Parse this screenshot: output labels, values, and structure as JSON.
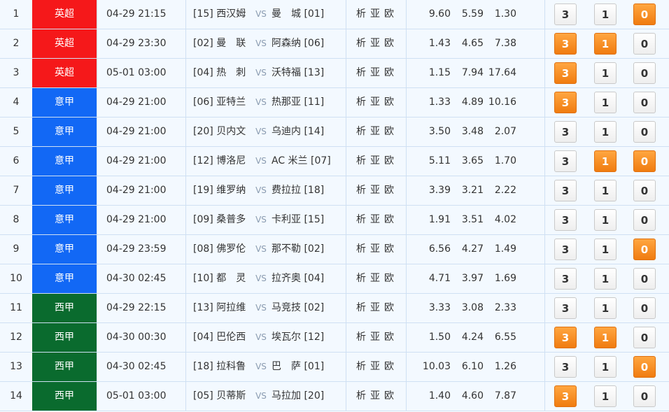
{
  "colors": {
    "epl": "#f5181a",
    "seriea": "#1268f5",
    "laliga": "#0a6b2e",
    "selected": "#f58a1a"
  },
  "separator": "VS",
  "links": "析亚欧",
  "rows": [
    {
      "num": "1",
      "league": "英超",
      "league_key": "epl",
      "time": "04-29 21:15",
      "home": "[15] 西汉姆",
      "away": "曼　城 [01]",
      "o1": "9.60",
      "o2": "5.59",
      "o3": "1.30",
      "p3": "3",
      "p1": "1",
      "p0": "0",
      "sel": [
        false,
        false,
        true
      ]
    },
    {
      "num": "2",
      "league": "英超",
      "league_key": "epl",
      "time": "04-29 23:30",
      "home": "[02] 曼　联",
      "away": "阿森纳 [06]",
      "o1": "1.43",
      "o2": "4.65",
      "o3": "7.38",
      "p3": "3",
      "p1": "1",
      "p0": "0",
      "sel": [
        true,
        true,
        false
      ]
    },
    {
      "num": "3",
      "league": "英超",
      "league_key": "epl",
      "time": "05-01 03:00",
      "home": "[04] 热　刺",
      "away": "沃特福 [13]",
      "o1": "1.15",
      "o2": "7.94",
      "o3": "17.64",
      "p3": "3",
      "p1": "1",
      "p0": "0",
      "sel": [
        true,
        false,
        false
      ]
    },
    {
      "num": "4",
      "league": "意甲",
      "league_key": "seriea",
      "time": "04-29 21:00",
      "home": "[06] 亚特兰",
      "away": "热那亚 [11]",
      "o1": "1.33",
      "o2": "4.89",
      "o3": "10.16",
      "p3": "3",
      "p1": "1",
      "p0": "0",
      "sel": [
        true,
        false,
        false
      ]
    },
    {
      "num": "5",
      "league": "意甲",
      "league_key": "seriea",
      "time": "04-29 21:00",
      "home": "[20] 贝内文",
      "away": "乌迪内 [14]",
      "o1": "3.50",
      "o2": "3.48",
      "o3": "2.07",
      "p3": "3",
      "p1": "1",
      "p0": "0",
      "sel": [
        false,
        false,
        false
      ]
    },
    {
      "num": "6",
      "league": "意甲",
      "league_key": "seriea",
      "time": "04-29 21:00",
      "home": "[12] 博洛尼",
      "away": "AC 米兰 [07]",
      "o1": "5.11",
      "o2": "3.65",
      "o3": "1.70",
      "p3": "3",
      "p1": "1",
      "p0": "0",
      "sel": [
        false,
        true,
        true
      ]
    },
    {
      "num": "7",
      "league": "意甲",
      "league_key": "seriea",
      "time": "04-29 21:00",
      "home": "[19] 维罗纳",
      "away": "费拉拉 [18]",
      "o1": "3.39",
      "o2": "3.21",
      "o3": "2.22",
      "p3": "3",
      "p1": "1",
      "p0": "0",
      "sel": [
        false,
        false,
        false
      ]
    },
    {
      "num": "8",
      "league": "意甲",
      "league_key": "seriea",
      "time": "04-29 21:00",
      "home": "[09] 桑普多",
      "away": "卡利亚 [15]",
      "o1": "1.91",
      "o2": "3.51",
      "o3": "4.02",
      "p3": "3",
      "p1": "1",
      "p0": "0",
      "sel": [
        false,
        false,
        false
      ]
    },
    {
      "num": "9",
      "league": "意甲",
      "league_key": "seriea",
      "time": "04-29 23:59",
      "home": "[08] 佛罗伦",
      "away": "那不勒 [02]",
      "o1": "6.56",
      "o2": "4.27",
      "o3": "1.49",
      "p3": "3",
      "p1": "1",
      "p0": "0",
      "sel": [
        false,
        false,
        true
      ]
    },
    {
      "num": "10",
      "league": "意甲",
      "league_key": "seriea",
      "time": "04-30 02:45",
      "home": "[10] 都　灵",
      "away": "拉齐奥 [04]",
      "o1": "4.71",
      "o2": "3.97",
      "o3": "1.69",
      "p3": "3",
      "p1": "1",
      "p0": "0",
      "sel": [
        false,
        false,
        false
      ]
    },
    {
      "num": "11",
      "league": "西甲",
      "league_key": "laliga",
      "time": "04-29 22:15",
      "home": "[13] 阿拉维",
      "away": "马竞技 [02]",
      "o1": "3.33",
      "o2": "3.08",
      "o3": "2.33",
      "p3": "3",
      "p1": "1",
      "p0": "0",
      "sel": [
        false,
        false,
        false
      ]
    },
    {
      "num": "12",
      "league": "西甲",
      "league_key": "laliga",
      "time": "04-30 00:30",
      "home": "[04] 巴伦西",
      "away": "埃瓦尔 [12]",
      "o1": "1.50",
      "o2": "4.24",
      "o3": "6.55",
      "p3": "3",
      "p1": "1",
      "p0": "0",
      "sel": [
        true,
        true,
        false
      ]
    },
    {
      "num": "13",
      "league": "西甲",
      "league_key": "laliga",
      "time": "04-30 02:45",
      "home": "[18] 拉科鲁",
      "away": "巴　萨 [01]",
      "o1": "10.03",
      "o2": "6.10",
      "o3": "1.26",
      "p3": "3",
      "p1": "1",
      "p0": "0",
      "sel": [
        false,
        false,
        true
      ]
    },
    {
      "num": "14",
      "league": "西甲",
      "league_key": "laliga",
      "time": "05-01 03:00",
      "home": "[05] 贝蒂斯",
      "away": "马拉加 [20]",
      "o1": "1.40",
      "o2": "4.60",
      "o3": "7.87",
      "p3": "3",
      "p1": "1",
      "p0": "0",
      "sel": [
        true,
        false,
        false
      ]
    }
  ]
}
